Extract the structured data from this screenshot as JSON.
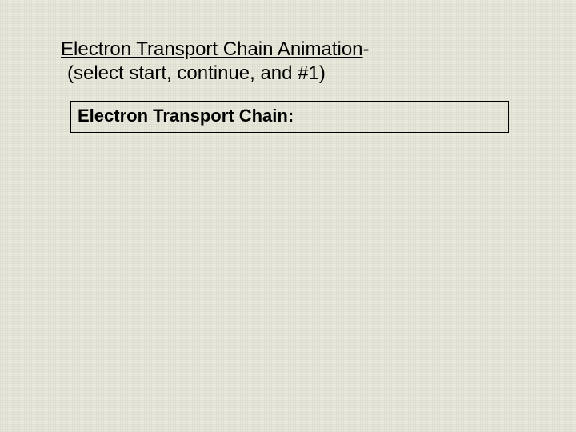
{
  "heading": {
    "link_text": "Electron Transport Chain Animation",
    "suffix": "-",
    "subtitle": "(select start, continue, and #1)"
  },
  "box": {
    "text": "Electron Transport Chain:"
  }
}
